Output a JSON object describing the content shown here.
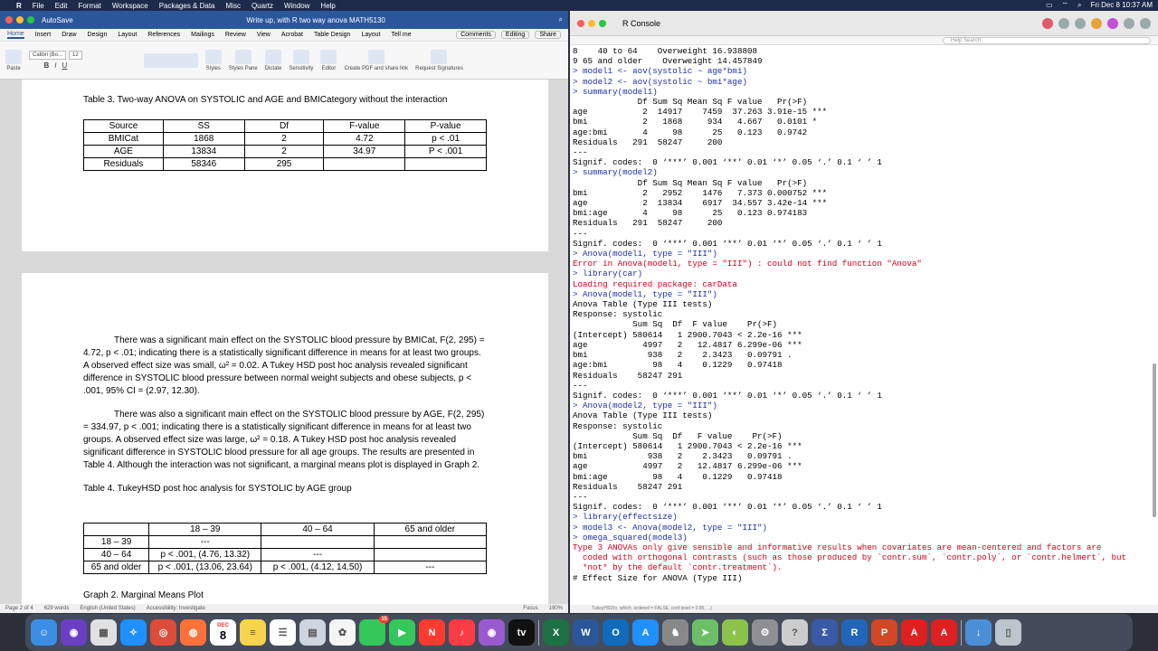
{
  "menubar": {
    "apple": "",
    "items": [
      "R",
      "File",
      "Edit",
      "Format",
      "Workspace",
      "Packages & Data",
      "Misc",
      "Quartz",
      "Window",
      "Help"
    ],
    "clock": "Fri Dec 8  10:37 AM"
  },
  "word": {
    "autosave": "AutoSave",
    "doc_title": "Write up, with R two way anova MATH5130",
    "tabs": [
      "Home",
      "Insert",
      "Draw",
      "Design",
      "Layout",
      "References",
      "Mailings",
      "Review",
      "View",
      "Acrobat",
      "Table Design",
      "Layout",
      "Tell me"
    ],
    "comments": "Comments",
    "editing": "Editing",
    "share": "Share",
    "font_name": "Calibri (Bo...",
    "font_size": "12",
    "ribbon_labels": [
      "Paste",
      "Styles",
      "Styles Pane",
      "Dictate",
      "Sensitivity",
      "Editor",
      "Create PDF and share link",
      "Request Signatures"
    ],
    "table3_caption": "Table 3. Two-way ANOVA on SYSTOLIC and AGE and BMICategory without the interaction",
    "table3": [
      [
        "Source",
        "SS",
        "Df",
        "F-value",
        "P-value"
      ],
      [
        "BMICat",
        "1868",
        "2",
        "4.72",
        "p < .01"
      ],
      [
        "AGE",
        "13834",
        "2",
        "34.97",
        "P < .001"
      ],
      [
        "Residuals",
        "58346",
        "295",
        "",
        ""
      ]
    ],
    "para1": "There was a significant main effect on the SYSTOLIC blood pressure by BMICat, F(2, 295) = 4.72, p < .01; indicating there is a statistically significant difference in means for at least two groups.  A observed effect size was small, ω² = 0.02.  A Tukey HSD post hoc analysis revealed significant difference in SYSTOLIC blood pressure between normal weight subjects and obese subjects, p < .001, 95% CI = (2.97, 12.30).",
    "para2": "There was also a significant main effect on the SYSTOLIC blood pressure by AGE, F(2, 295) = 334.97, p < .001; indicating there is a statistically significant difference in means for at least two groups.  A observed effect size was large, ω² = 0.18.  A Tukey HSD post hoc analysis revealed significant difference in SYSTOLIC blood pressure for all age groups.  The results are presented in Table 4.  Although the interaction was not significant, a marginal means plot is displayed in Graph 2.",
    "table4_caption": "Table 4.  TukeyHSD post hoc analysis for SYSTOLIC by AGE group",
    "table4": [
      [
        "",
        "18 – 39",
        "40 – 64",
        "65 and older"
      ],
      [
        "18 – 39",
        "---",
        "",
        ""
      ],
      [
        "40 – 64",
        "p < .001, (4.76, 13.32)",
        "---",
        ""
      ],
      [
        "65 and older",
        "p < .001, (13.06, 23.64)",
        "p < .001, (4.12, 14.50)",
        "---"
      ]
    ],
    "graph2_caption": "Graph 2. Marginal Means Plot",
    "status": {
      "page": "Page 2 of 4",
      "words": "629 words",
      "lang": "English (United States)",
      "access": "Accessibility: Investigate",
      "focus": "Focus",
      "zoom": "190%"
    }
  },
  "rconsole": {
    "title": "R Console",
    "search_placeholder": "Help Search",
    "lines": [
      {
        "t": "o",
        "s": "8    40 to 64    Overweight 16.938808"
      },
      {
        "t": "o",
        "s": "9 65 and older    Overweight 14.457849"
      },
      {
        "t": "i",
        "s": "> model1 <- aov(systolic ~ age*bmi)"
      },
      {
        "t": "i",
        "s": "> model2 <- aov(systolic ~ bmi*age)"
      },
      {
        "t": "i",
        "s": "> summary(model1)"
      },
      {
        "t": "o",
        "s": "             Df Sum Sq Mean Sq F value   Pr(>F)    "
      },
      {
        "t": "o",
        "s": "age           2  14917    7459  37.263 3.91e-15 ***"
      },
      {
        "t": "o",
        "s": "bmi           2   1868     934   4.667   0.0101 *  "
      },
      {
        "t": "o",
        "s": "age:bmi       4     98      25   0.123   0.9742    "
      },
      {
        "t": "o",
        "s": "Residuals   291  58247     200                     "
      },
      {
        "t": "o",
        "s": "---"
      },
      {
        "t": "o",
        "s": "Signif. codes:  0 ‘***’ 0.001 ‘**’ 0.01 ‘*’ 0.05 ‘.’ 0.1 ‘ ’ 1"
      },
      {
        "t": "i",
        "s": "> summary(model2)"
      },
      {
        "t": "o",
        "s": "             Df Sum Sq Mean Sq F value   Pr(>F)    "
      },
      {
        "t": "o",
        "s": "bmi           2   2952    1476   7.373 0.000752 ***"
      },
      {
        "t": "o",
        "s": "age           2  13834    6917  34.557 3.42e-14 ***"
      },
      {
        "t": "o",
        "s": "bmi:age       4     98      25   0.123 0.974183    "
      },
      {
        "t": "o",
        "s": "Residuals   291  58247     200                     "
      },
      {
        "t": "o",
        "s": "---"
      },
      {
        "t": "o",
        "s": "Signif. codes:  0 ‘***’ 0.001 ‘**’ 0.01 ‘*’ 0.05 ‘.’ 0.1 ‘ ’ 1"
      },
      {
        "t": "i",
        "s": "> Anova(model1, type = \"III\")"
      },
      {
        "t": "e",
        "s": "Error in Anova(model1, type = \"III\") : could not find function \"Anova\""
      },
      {
        "t": "i",
        "s": "> library(car)"
      },
      {
        "t": "e",
        "s": "Loading required package: carData"
      },
      {
        "t": "i",
        "s": "> Anova(model1, type = \"III\")"
      },
      {
        "t": "o",
        "s": "Anova Table (Type III tests)"
      },
      {
        "t": "o",
        "s": ""
      },
      {
        "t": "o",
        "s": "Response: systolic"
      },
      {
        "t": "o",
        "s": "            Sum Sq  Df  F value    Pr(>F)    "
      },
      {
        "t": "o",
        "s": "(Intercept) 580614   1 2900.7043 < 2.2e-16 ***"
      },
      {
        "t": "o",
        "s": "age           4997   2   12.4817 6.299e-06 ***"
      },
      {
        "t": "o",
        "s": "bmi            938   2    2.3423   0.09791 .  "
      },
      {
        "t": "o",
        "s": "age:bmi         98   4    0.1229   0.97418    "
      },
      {
        "t": "o",
        "s": "Residuals    58247 291                        "
      },
      {
        "t": "o",
        "s": "---"
      },
      {
        "t": "o",
        "s": "Signif. codes:  0 ‘***’ 0.001 ‘**’ 0.01 ‘*’ 0.05 ‘.’ 0.1 ‘ ’ 1"
      },
      {
        "t": "i",
        "s": "> Anova(model2, type = \"III\")"
      },
      {
        "t": "o",
        "s": "Anova Table (Type III tests)"
      },
      {
        "t": "o",
        "s": ""
      },
      {
        "t": "o",
        "s": "Response: systolic"
      },
      {
        "t": "o",
        "s": "            Sum Sq  Df   F value    Pr(>F)    "
      },
      {
        "t": "o",
        "s": "(Intercept) 580614   1 2900.7043 < 2.2e-16 ***"
      },
      {
        "t": "o",
        "s": "bmi            938   2    2.3423   0.09791 .  "
      },
      {
        "t": "o",
        "s": "age           4997   2   12.4817 6.299e-06 ***"
      },
      {
        "t": "o",
        "s": "bmi:age         98   4    0.1229   0.97418    "
      },
      {
        "t": "o",
        "s": "Residuals    58247 291                        "
      },
      {
        "t": "o",
        "s": "---"
      },
      {
        "t": "o",
        "s": "Signif. codes:  0 ‘***’ 0.001 ‘**’ 0.01 ‘*’ 0.05 ‘.’ 0.1 ‘ ’ 1"
      },
      {
        "t": "i",
        "s": "> library(effectsize)"
      },
      {
        "t": "i",
        "s": "> model3 <- Anova(model2, type = \"III\")"
      },
      {
        "t": "i",
        "s": "> omega_squared(model3)"
      },
      {
        "t": "e",
        "s": "Type 3 ANOVAs only give sensible and informative results when covariates are mean-centered and factors are"
      },
      {
        "t": "e",
        "s": "  coded with orthogonal contrasts (such as those produced by `contr.sum`, `contr.poly`, or `contr.helmert`, but"
      },
      {
        "t": "e",
        "s": "  *not* by the default `contr.treatment`)."
      },
      {
        "t": "o",
        "s": "# Effect Size for ANOVA (Type III)"
      }
    ],
    "status": "TukeyHSD(x, which, ordered = FALSE, conf.level = 0.95, ...)"
  },
  "dock": {
    "calendar_month": "DEC",
    "calendar_day": "8",
    "badge": "15",
    "apps": [
      {
        "name": "finder-icon",
        "c": "#3a8ee6",
        "g": "☺"
      },
      {
        "name": "siri-icon",
        "c": "#6a3fc4",
        "g": "◉"
      },
      {
        "name": "launchpad-icon",
        "c": "#e0e0e0",
        "g": "▦"
      },
      {
        "name": "safari-icon",
        "c": "#1e90ff",
        "g": "✧"
      },
      {
        "name": "chrome-icon",
        "c": "#dd4b39",
        "g": "◎"
      },
      {
        "name": "firefox-icon",
        "c": "#ff7139",
        "g": "◍"
      },
      {
        "name": "calendar-icon",
        "c": "#ffffff",
        "g": ""
      },
      {
        "name": "notes-icon",
        "c": "#f7d44c",
        "g": "≡"
      },
      {
        "name": "reminders-icon",
        "c": "#ffffff",
        "g": "☰"
      },
      {
        "name": "preview-icon",
        "c": "#cdd6e0",
        "g": "▤"
      },
      {
        "name": "photos-icon",
        "c": "#f5f5f5",
        "g": "✿"
      },
      {
        "name": "messages-icon",
        "c": "#34c759",
        "g": "✉"
      },
      {
        "name": "facetime-icon",
        "c": "#34c759",
        "g": "▶"
      },
      {
        "name": "news-icon",
        "c": "#ff3b30",
        "g": "N"
      },
      {
        "name": "music-icon",
        "c": "#fc3c44",
        "g": "♪"
      },
      {
        "name": "podcasts-icon",
        "c": "#9b59d0",
        "g": "◉"
      },
      {
        "name": "tv-icon",
        "c": "#111111",
        "g": "tv"
      },
      {
        "name": "excel-icon",
        "c": "#1d7044",
        "g": "X"
      },
      {
        "name": "word-icon",
        "c": "#2b579a",
        "g": "W"
      },
      {
        "name": "outlook-icon",
        "c": "#0f6cbd",
        "g": "O"
      },
      {
        "name": "appstore-icon",
        "c": "#1e90ff",
        "g": "A"
      },
      {
        "name": "chess-icon",
        "c": "#888888",
        "g": "♞"
      },
      {
        "name": "maps-icon",
        "c": "#6dbf67",
        "g": "➤"
      },
      {
        "name": "geogebra-icon",
        "c": "#8bc34a",
        "g": "◐"
      },
      {
        "name": "settings-icon",
        "c": "#8e8e93",
        "g": "⚙"
      },
      {
        "name": "help-icon",
        "c": "#cccccc",
        "g": "?"
      },
      {
        "name": "sigma-icon",
        "c": "#3a5aa8",
        "g": "Σ"
      },
      {
        "name": "r-icon",
        "c": "#2266bb",
        "g": "R"
      },
      {
        "name": "powerpoint-icon",
        "c": "#d24726",
        "g": "P"
      },
      {
        "name": "acrobat-icon",
        "c": "#e02020",
        "g": "A"
      },
      {
        "name": "acrobat2-icon",
        "c": "#e02020",
        "g": "A"
      },
      {
        "name": "downloads-icon",
        "c": "#4a90d9",
        "g": "↓"
      },
      {
        "name": "trash-icon",
        "c": "#bcc4cc",
        "g": "▯"
      }
    ]
  },
  "colors": {
    "word_blue": "#2b579a",
    "r_input": "#1b2fa8",
    "r_error": "#d0021b"
  }
}
